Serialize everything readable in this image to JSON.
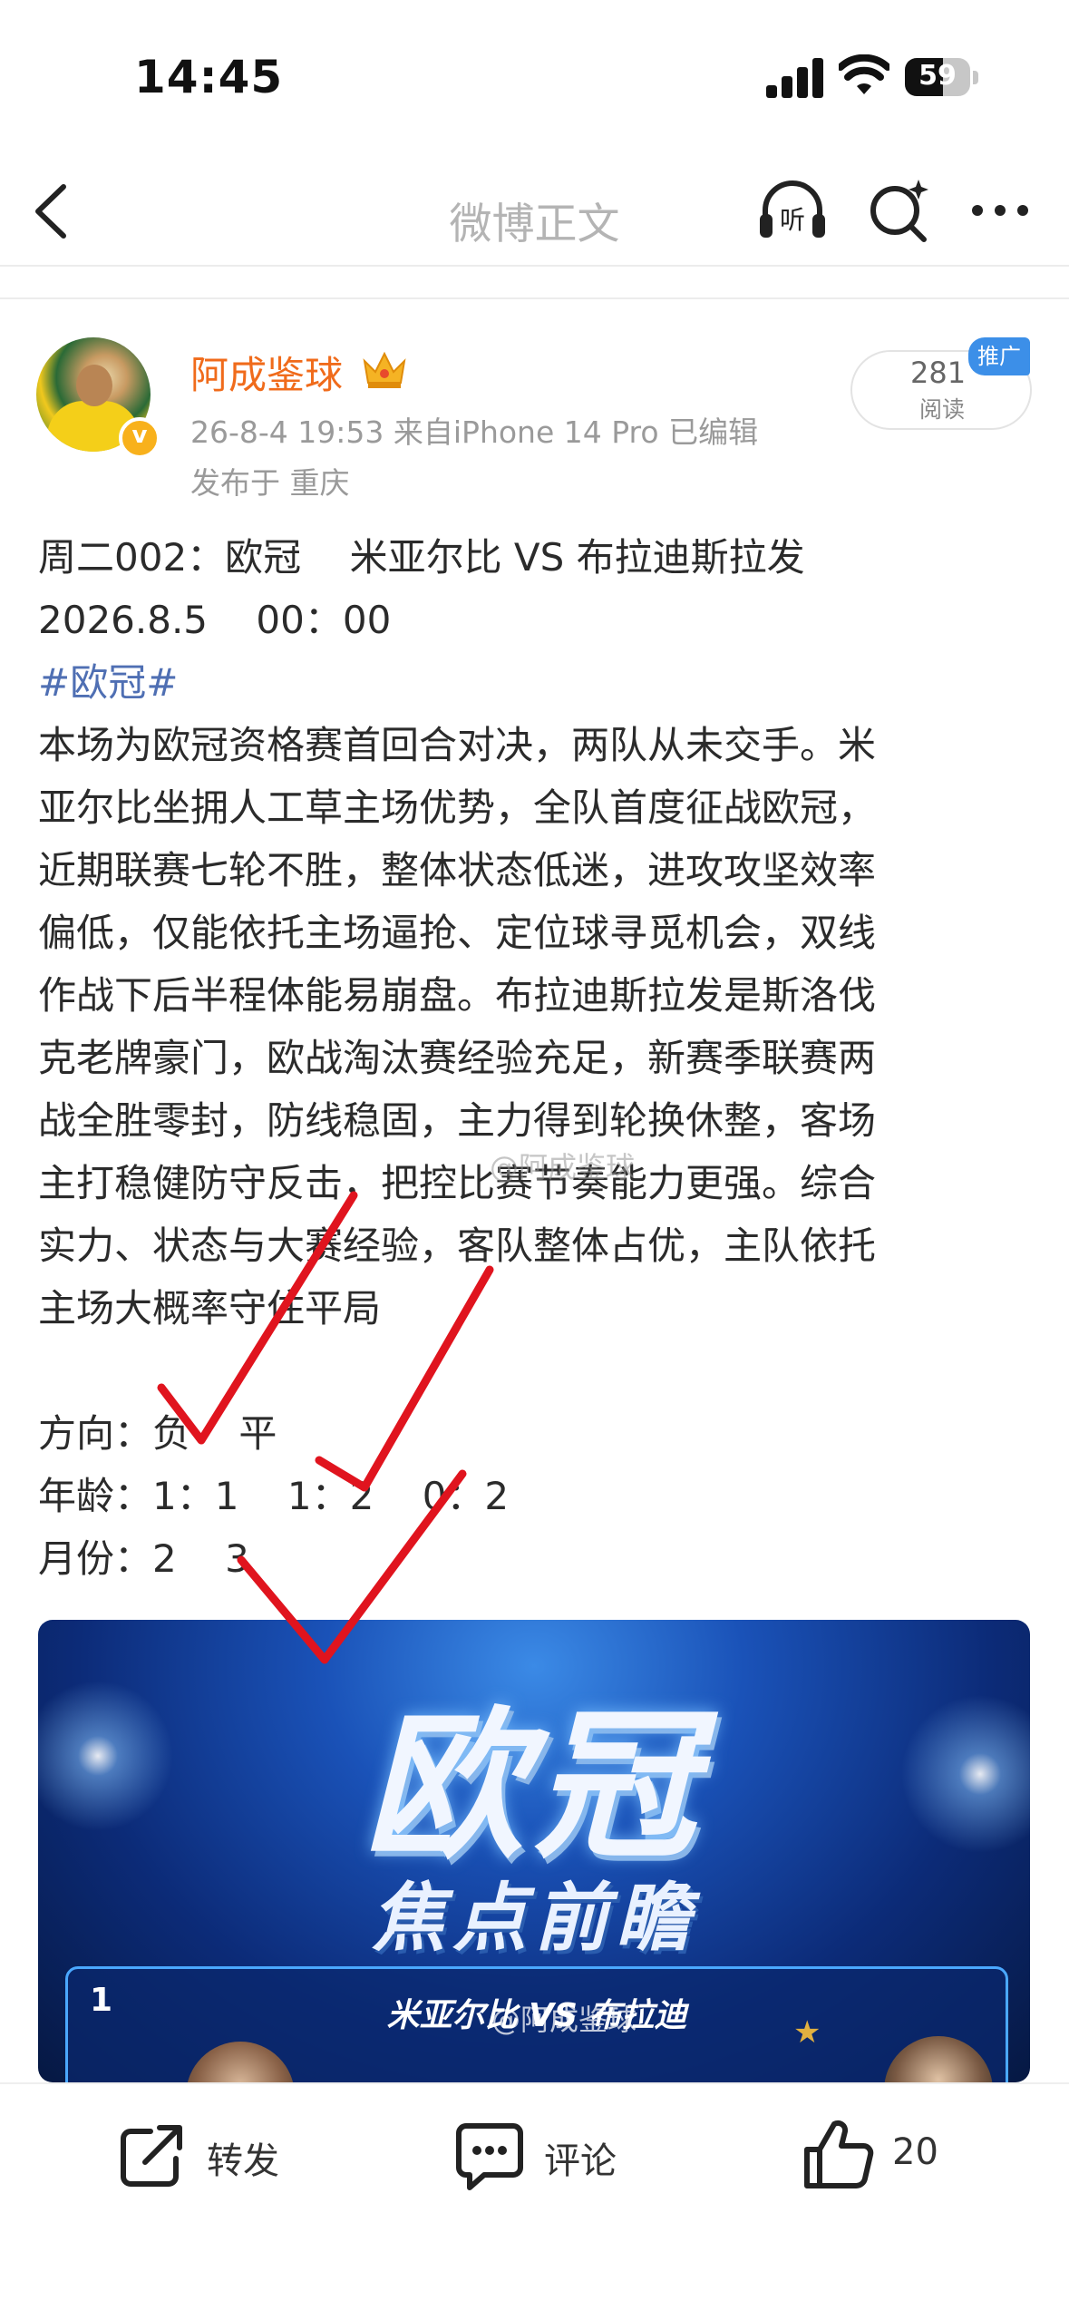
{
  "status_bar": {
    "time": "14:45",
    "battery": "59"
  },
  "nav": {
    "title": "微博正文"
  },
  "post": {
    "username": "阿成鉴球",
    "meta": "26-8-4 19:53  来自iPhone 14 Pro  已编辑",
    "location": "发布于 重庆",
    "read_count": "281",
    "read_label": "阅读",
    "promo_tag": "推广",
    "body_lines": [
      "周二002：欧冠    米亚尔比 VS 布拉迪斯拉发",
      "2026.8.5    00：00"
    ],
    "hashtag": "#欧冠#",
    "paragraph_lines": [
      "本场为欧冠资格赛首回合对决，两队从未交手。米",
      "亚尔比坐拥人工草主场优势，全队首度征战欧冠，",
      "近期联赛七轮不胜，整体状态低迷，进攻攻坚效率",
      "偏低，仅能依托主场逼抢、定位球寻觅机会，双线",
      "作战下后半程体能易崩盘。布拉迪斯拉发是斯洛伐",
      "克老牌豪门，欧战淘汰赛经验充足，新赛季联赛两",
      "战全胜零封，防线稳固，主力得到轮换休整，客场",
      "主打稳健防守反击，把控比赛节奏能力更强。综合",
      "实力、状态与大赛经验，客队整体占优，主队依托",
      "主场大概率守住平局"
    ],
    "picks": [
      "方向：负    平",
      "年龄：1：1    1：2    0：2",
      "月份：2    3"
    ],
    "watermark": "@阿成鉴球"
  },
  "image": {
    "title": "欧冠",
    "subtitle": "焦点前瞻",
    "match_number": "1",
    "match_title": "米亚尔比 VS 布拉迪",
    "watermark": "@阿成鉴球"
  },
  "bottom_bar": {
    "repost_label": "转发",
    "comment_label": "评论",
    "like_count": "20"
  },
  "colors": {
    "username": "#f06b1b",
    "hashtag": "#4f6fb3",
    "checkmark": "#e0141e",
    "promo": "#3c8fe8"
  },
  "icons": [
    "back-icon",
    "listen-icon",
    "search-icon",
    "more-icon",
    "crown-icon",
    "verified-icon",
    "repost-icon",
    "comment-icon",
    "like-icon"
  ]
}
